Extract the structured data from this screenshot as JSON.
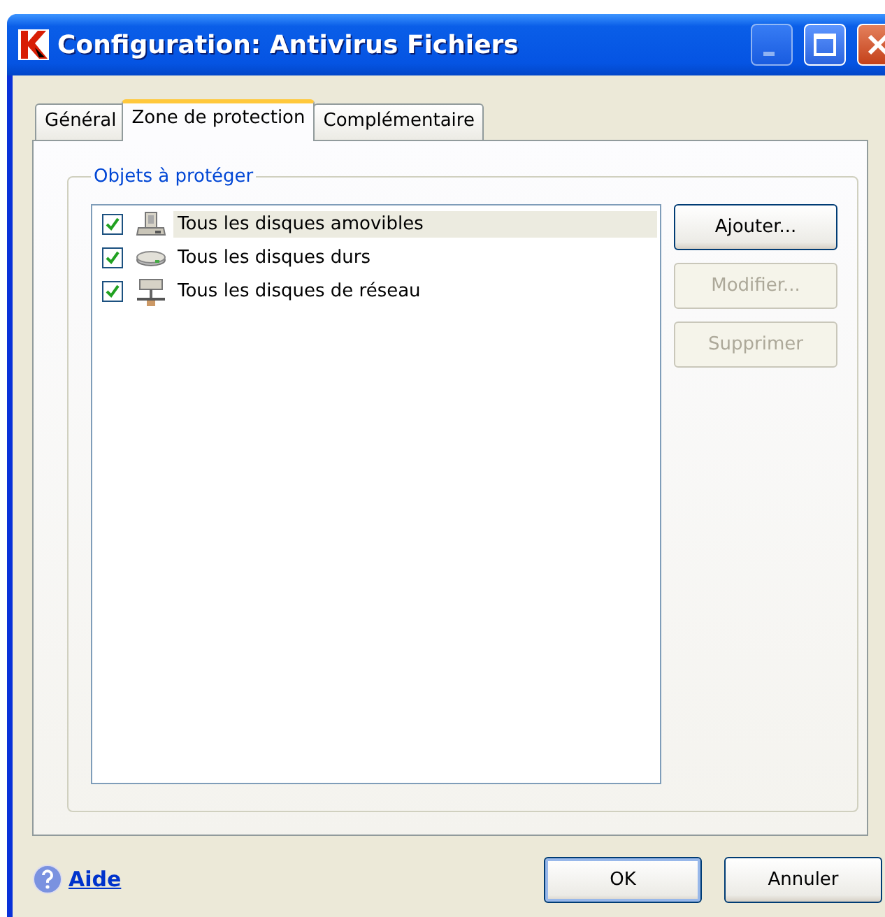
{
  "window": {
    "title": "Configuration: Antivirus Fichiers"
  },
  "tabs": [
    {
      "label": "Général",
      "selected": false
    },
    {
      "label": "Zone de protection",
      "selected": true
    },
    {
      "label": "Complémentaire",
      "selected": false
    }
  ],
  "group": {
    "title": "Objets à protéger"
  },
  "items": [
    {
      "label": "Tous les disques amovibles",
      "kind": "removable",
      "checked": true,
      "selected": true
    },
    {
      "label": "Tous les disques durs",
      "kind": "hdd",
      "checked": true,
      "selected": false
    },
    {
      "label": "Tous les disques de réseau",
      "kind": "network",
      "checked": true,
      "selected": false
    }
  ],
  "side_buttons": [
    {
      "label": "Ajouter...",
      "disabled": false
    },
    {
      "label": "Modifier...",
      "disabled": true
    },
    {
      "label": "Supprimer",
      "disabled": true
    }
  ],
  "help_link": "Aide",
  "buttons": [
    {
      "label": "OK",
      "default": true
    },
    {
      "label": "Annuler",
      "default": false
    }
  ]
}
